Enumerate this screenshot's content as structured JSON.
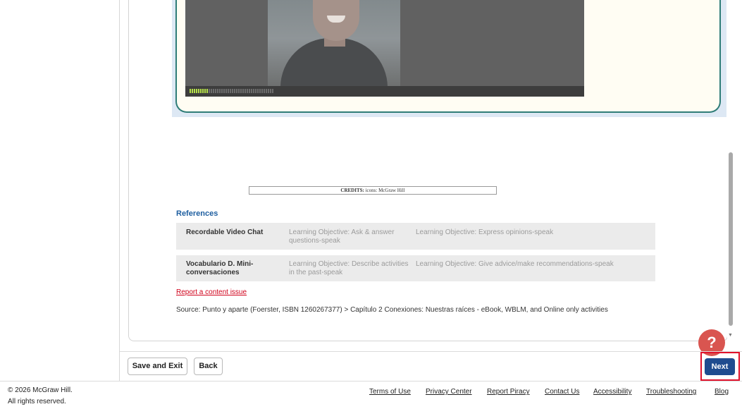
{
  "video": {
    "level_on": 9,
    "level_total": 40
  },
  "credits": {
    "label": "CREDITS:",
    "text": "icons: McGraw Hill"
  },
  "references": {
    "title": "References",
    "rows": [
      {
        "name": "Recordable Video Chat",
        "objective_1": "Learning Objective: Ask & answer questions-speak",
        "objective_2": "Learning Objective: Express opinions-speak"
      },
      {
        "name": "Vocabulario D. Mini-conversaciones",
        "objective_1": "Learning Objective: Describe activities in the past-speak",
        "objective_2": "Learning Objective: Give advice/make recommendations-speak"
      }
    ]
  },
  "report_link": "Report a content issue",
  "source": "Source: Punto y aparte (Foerster, ISBN 1260267377) > Capítulo 2 Conexiones: Nuestras raíces - eBook, WBLM, and Online only activities",
  "help": {
    "glyph": "?"
  },
  "actions": {
    "save_exit": "Save and Exit",
    "back": "Back",
    "next": "Next"
  },
  "footer": {
    "copyright_line1": "© 2026 McGraw Hill.",
    "copyright_line2": "All rights reserved.",
    "links": [
      "Terms of Use",
      "Privacy Center",
      "Report Piracy",
      "Contact Us",
      "Accessibility",
      "Troubleshooting",
      "Blog"
    ]
  },
  "colors": {
    "accent": "#1f4c8f",
    "frame": "#2f7d78",
    "report": "#d0021b",
    "highlight": "#e0112b",
    "help": "#d95550"
  }
}
